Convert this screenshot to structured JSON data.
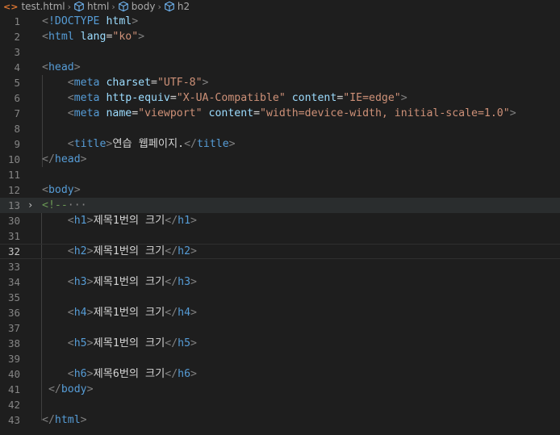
{
  "breadcrumb": {
    "file": "test.html",
    "items": [
      "html",
      "body",
      "h2"
    ],
    "file_icon": "html-file-icon",
    "item_icon": "cube-icon"
  },
  "lines": [
    {
      "num": "1",
      "code": "<!DOCTYPE html>"
    },
    {
      "num": "2",
      "code": "<html lang=\"ko\">"
    },
    {
      "num": "3",
      "code": ""
    },
    {
      "num": "4",
      "code": "<head>"
    },
    {
      "num": "5",
      "code": "    <meta charset=\"UTF-8\">"
    },
    {
      "num": "6",
      "code": "    <meta http-equiv=\"X-UA-Compatible\" content=\"IE=edge\">"
    },
    {
      "num": "7",
      "code": "    <meta name=\"viewport\" content=\"width=device-width, initial-scale=1.0\">"
    },
    {
      "num": "8",
      "code": ""
    },
    {
      "num": "9",
      "code": "    <title>연습 웹페이지.</title>"
    },
    {
      "num": "10",
      "code": "</head>"
    },
    {
      "num": "11",
      "code": ""
    },
    {
      "num": "12",
      "code": "<body>"
    },
    {
      "num": "13",
      "code": "<!--···"
    },
    {
      "num": "30",
      "code": "    <h1>제목1번의 크기</h1>"
    },
    {
      "num": "31",
      "code": ""
    },
    {
      "num": "32",
      "code": "    <h2>제목1번의 크기</h2>"
    },
    {
      "num": "33",
      "code": ""
    },
    {
      "num": "34",
      "code": "    <h3>제목1번의 크기</h3>"
    },
    {
      "num": "35",
      "code": ""
    },
    {
      "num": "36",
      "code": "    <h4>제목1번의 크기</h4>"
    },
    {
      "num": "37",
      "code": ""
    },
    {
      "num": "38",
      "code": "    <h5>제목1번의 크기</h5>"
    },
    {
      "num": "39",
      "code": ""
    },
    {
      "num": "40",
      "code": "    <h6>제목6번의 크기</h6>"
    },
    {
      "num": "41",
      "code": " </body>"
    },
    {
      "num": "42",
      "code": ""
    },
    {
      "num": "43",
      "code": "</html>"
    }
  ],
  "current_line": "32",
  "folded_line": "13",
  "colors": {
    "background": "#1e1e1e",
    "tag": "#569cd6",
    "attribute": "#9cdcfe",
    "string": "#ce9178",
    "comment": "#6a9955",
    "line_number": "#858585"
  }
}
